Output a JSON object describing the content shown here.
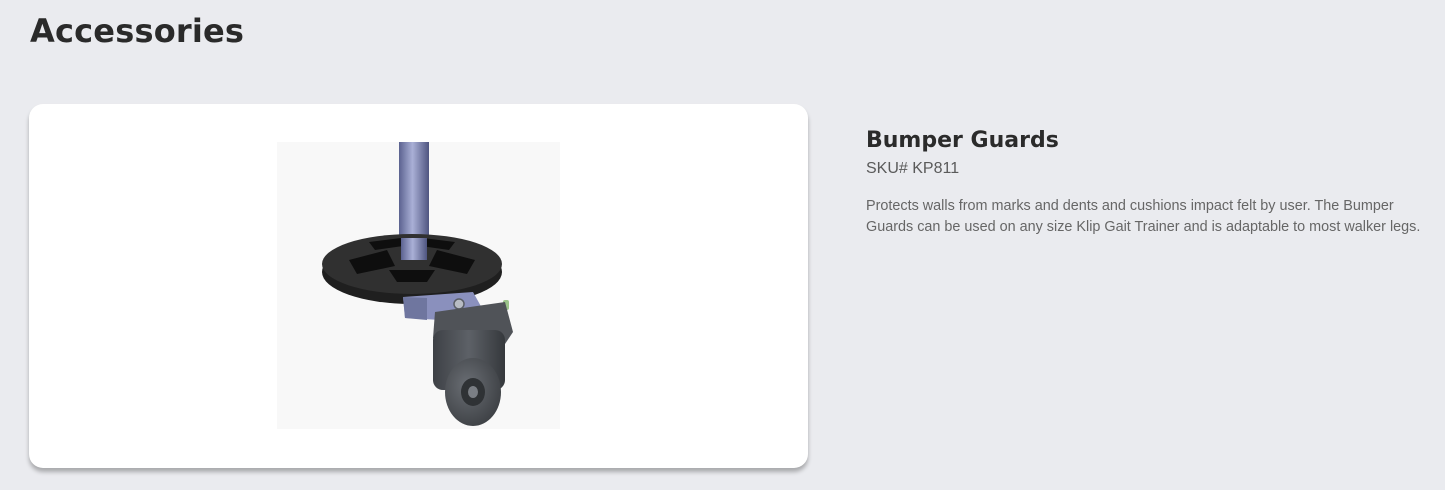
{
  "page": {
    "title": "Accessories"
  },
  "product": {
    "name": "Bumper Guards",
    "sku": "SKU# KP811",
    "description": "Protects walls from marks and dents and cushions impact felt by user. The Bumper Guards can be used on any size Klip Gait Trainer and is adaptable to most walker legs.",
    "image_icon": "bumper-guard-caster-photo"
  },
  "colors": {
    "background": "#eaebef",
    "card": "#ffffff",
    "pole": "#7f86b4",
    "bumper": "#2b2b2b",
    "caster": "#4a4d52"
  }
}
